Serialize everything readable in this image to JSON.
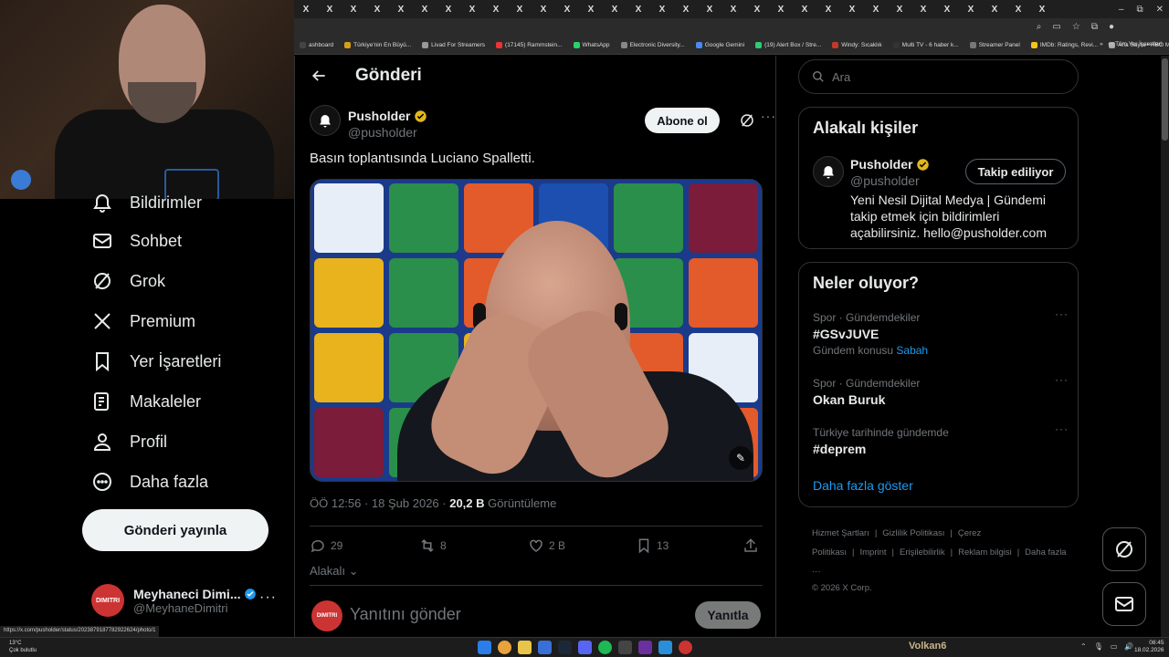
{
  "browser": {
    "tab_glyph": "X",
    "tab_count": 32,
    "window_controls": [
      "–",
      "⧉",
      "✕"
    ],
    "bookmarks": [
      {
        "label": "ashboard",
        "color": "#444"
      },
      {
        "label": "Türkiye'nin En Büyü...",
        "color": "#d4a017"
      },
      {
        "label": "Livad For Streamers",
        "color": "#999"
      },
      {
        "label": "(17145) Rammstein...",
        "color": "#e33"
      },
      {
        "label": "WhatsApp",
        "color": "#25d366"
      },
      {
        "label": "Electronic Diversity...",
        "color": "#888"
      },
      {
        "label": "Google Gemini",
        "color": "#4a8af4"
      },
      {
        "label": "(19) Alert Box / Stre...",
        "color": "#2ecc71"
      },
      {
        "label": "Windy: Sıcaklık",
        "color": "#c0392b"
      },
      {
        "label": "Multi TV - 6 haber k...",
        "color": "#333"
      },
      {
        "label": "Streamer Panel",
        "color": "#777"
      },
      {
        "label": "IMDb: Ratings, Revi...",
        "color": "#f5c518"
      },
      {
        "label": "Ana Sayfa • HBO Max",
        "color": "#aaa"
      }
    ],
    "bookmarks_more": "»",
    "bookmarks_folder": "Tüm Yer İşaretleri",
    "status_url": "https://x.com/pusholder/status/2023879187782922624/photo/1"
  },
  "nav": {
    "items": [
      {
        "label": "Bildirimler",
        "icon": "bell-icon"
      },
      {
        "label": "Sohbet",
        "icon": "mail-icon"
      },
      {
        "label": "Grok",
        "icon": "grok-icon"
      },
      {
        "label": "Premium",
        "icon": "x-logo-icon"
      },
      {
        "label": "Yer İşaretleri",
        "icon": "bookmark-icon"
      },
      {
        "label": "Makaleler",
        "icon": "article-icon"
      },
      {
        "label": "Profil",
        "icon": "profile-icon"
      },
      {
        "label": "Daha fazla",
        "icon": "more-circle-icon"
      }
    ],
    "post_button": "Gönderi yayınla",
    "account": {
      "name": "Meyhaneci Dimi...",
      "handle": "@MeyhaneDimitri",
      "avatar_text": "DIMITRI",
      "more": "···"
    }
  },
  "main": {
    "title": "Gönderi",
    "tweet": {
      "author_name": "Pusholder",
      "author_handle": "@pusholder",
      "follow_label": "Abone ol",
      "more": "···",
      "text": "Basın toplantısında Luciano Spalletti.",
      "time": "ÖÖ 12:56 · 18 Şub 2026 · ",
      "views_count": "20,2 B",
      "views_label": " Görüntüleme",
      "replies": "29",
      "retweets": "8",
      "likes": "2 B",
      "bookmarks": "13",
      "related_label": "Alakalı"
    },
    "reply": {
      "placeholder": "Yanıtını gönder",
      "button": "Yanıtla",
      "avatar_text": "DIMITRI"
    }
  },
  "right": {
    "search_placeholder": "Ara",
    "related_people": {
      "title": "Alakalı kişiler",
      "name": "Pusholder",
      "handle": "@pusholder",
      "follow_state": "Takip ediliyor",
      "bio": "Yeni Nesil Dijital Medya | Gündemi takip etmek için bildirimleri açabilirsiniz. hello@pusholder.com"
    },
    "trends": {
      "title": "Neler oluyor?",
      "items": [
        {
          "category": "Spor · Gündemdekiler",
          "name": "#GSvJUVE",
          "sub_prefix": "Gündem konusu ",
          "sub_link": "Sabah"
        },
        {
          "category": "Spor · Gündemdekiler",
          "name": "Okan Buruk",
          "sub_prefix": "",
          "sub_link": ""
        },
        {
          "category": "Türkiye tarihinde gündemde",
          "name": "#deprem",
          "sub_prefix": "",
          "sub_link": ""
        }
      ],
      "more_dots": "···",
      "show_more": "Daha fazla göster"
    },
    "footer": {
      "links": [
        "Hizmet Şartları",
        "|",
        "Gizlilik Politikası",
        "|",
        "Çerez Politikası",
        "|",
        "Imprint",
        "|",
        "Erişilebilirlik",
        "|",
        "Reklam bilgisi",
        "|",
        "Daha fazla ···"
      ],
      "copyright": "© 2026 X Corp."
    }
  },
  "taskbar": {
    "weather_temp": "13°C",
    "weather_desc": "Çok bulutlu",
    "user": "Volkan6",
    "time": "08:45",
    "date": "18.02.2026",
    "tray": [
      "⌃",
      "🎙",
      "▭",
      "🔊"
    ]
  },
  "colors": {
    "accent": "#1d9bf0",
    "verified": "#e2b719",
    "background": "#000000",
    "border": "#2f3336"
  }
}
